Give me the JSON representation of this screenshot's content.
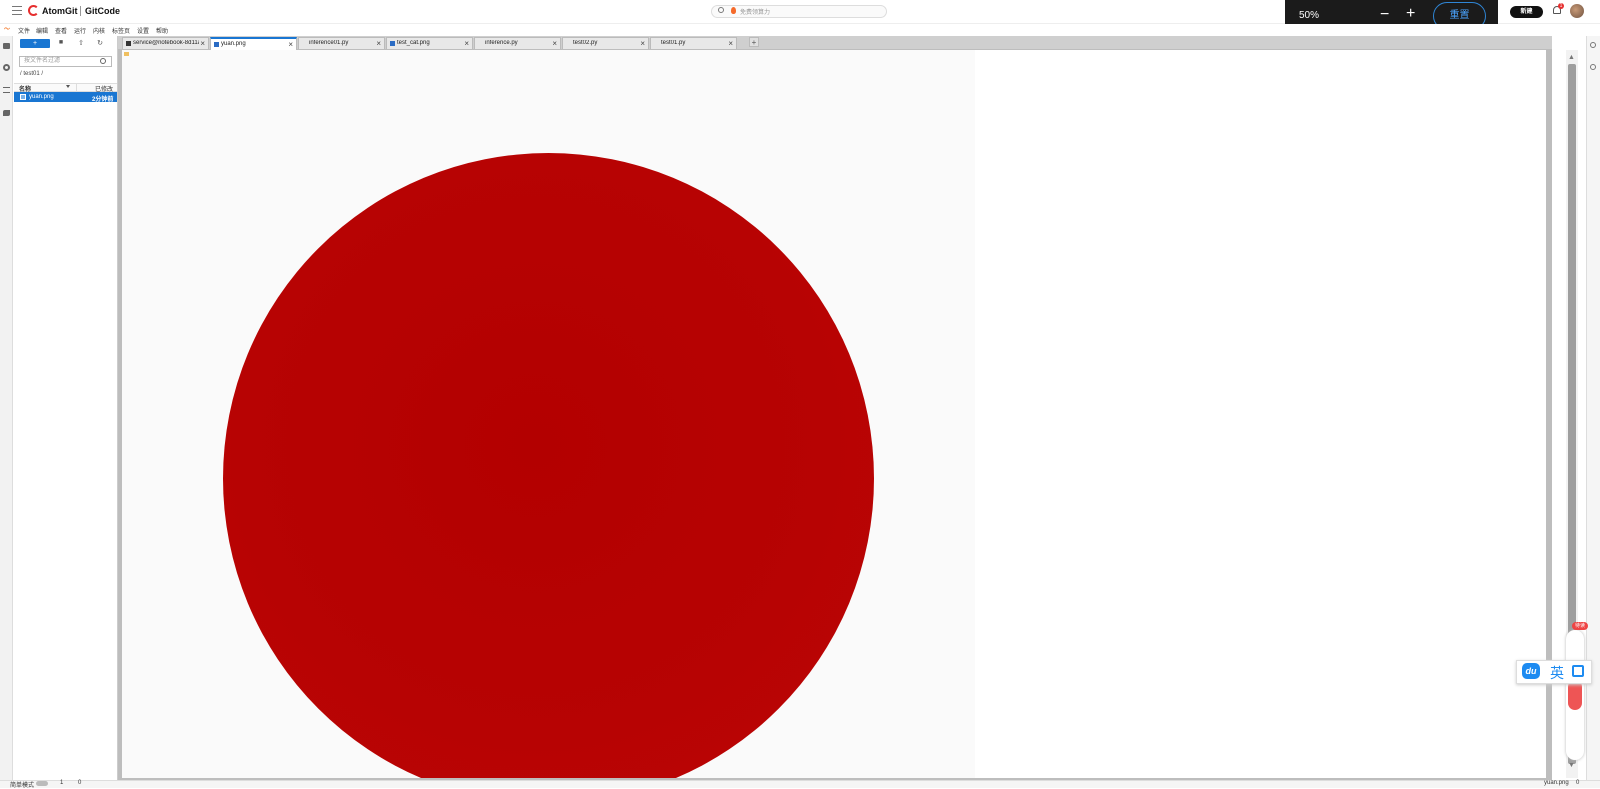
{
  "topbar": {
    "brand1": "AtomGit",
    "brand2": "GitCode",
    "search_placeholder": "免费领算力",
    "new_button": "新建",
    "notification_count": "1"
  },
  "zoom": {
    "value": "50%",
    "minus": "−",
    "plus": "+",
    "reset": "重置"
  },
  "menu": [
    "文件",
    "编辑",
    "查看",
    "运行",
    "内核",
    "标签页",
    "设置",
    "帮助"
  ],
  "filebrowser": {
    "new_label": "+",
    "filter_placeholder": "按文件名过滤",
    "breadcrumb": "/ test01 /",
    "col_name": "名称",
    "col_modified": "已修改",
    "file_name": "yuan.png",
    "file_modified": "2分钟前"
  },
  "tabs": [
    {
      "label": "service@notebook-8d11a",
      "active": false
    },
    {
      "label": "yuan.png",
      "active": true
    },
    {
      "label": "inference01.py",
      "active": false
    },
    {
      "label": "test_cat.png",
      "active": false
    },
    {
      "label": "inference.py",
      "active": false
    },
    {
      "label": "test02.py",
      "active": false
    },
    {
      "label": "test01.py",
      "active": false
    }
  ],
  "float": {
    "badge": "待读",
    "ime_lang": "英",
    "ime_logo": "du"
  },
  "statusbar": {
    "mode_label": "简单模式",
    "kernel_count": "1",
    "terminal_count": "0",
    "current_file": "yuan.png",
    "notification_count": "0"
  },
  "colors": {
    "accent": "#1976d2",
    "circle": "#b50303",
    "brand": "#e62e2e"
  }
}
